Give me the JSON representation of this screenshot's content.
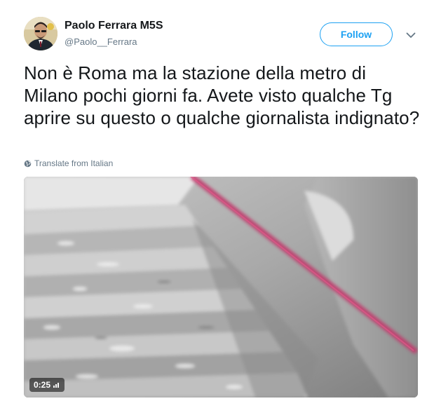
{
  "user": {
    "display_name": "Paolo Ferrara M5S",
    "handle": "@Paolo__Ferrara",
    "avatar_icon": "profile-photo"
  },
  "actions": {
    "follow_label": "Follow",
    "more_icon": "chevron-down-icon"
  },
  "tweet": {
    "text": "Non è Roma ma la stazione della metro di Milano pochi giorni fa. Avete visto qualche Tg aprire su questo o qualche giornalista indignato?",
    "translate_label": "Translate from Italian"
  },
  "media": {
    "type": "video",
    "duration": "0:25",
    "volume_icon": "volume-bars-icon"
  },
  "colors": {
    "accent": "#1da1f2",
    "text": "#14171a",
    "secondary": "#657786"
  }
}
